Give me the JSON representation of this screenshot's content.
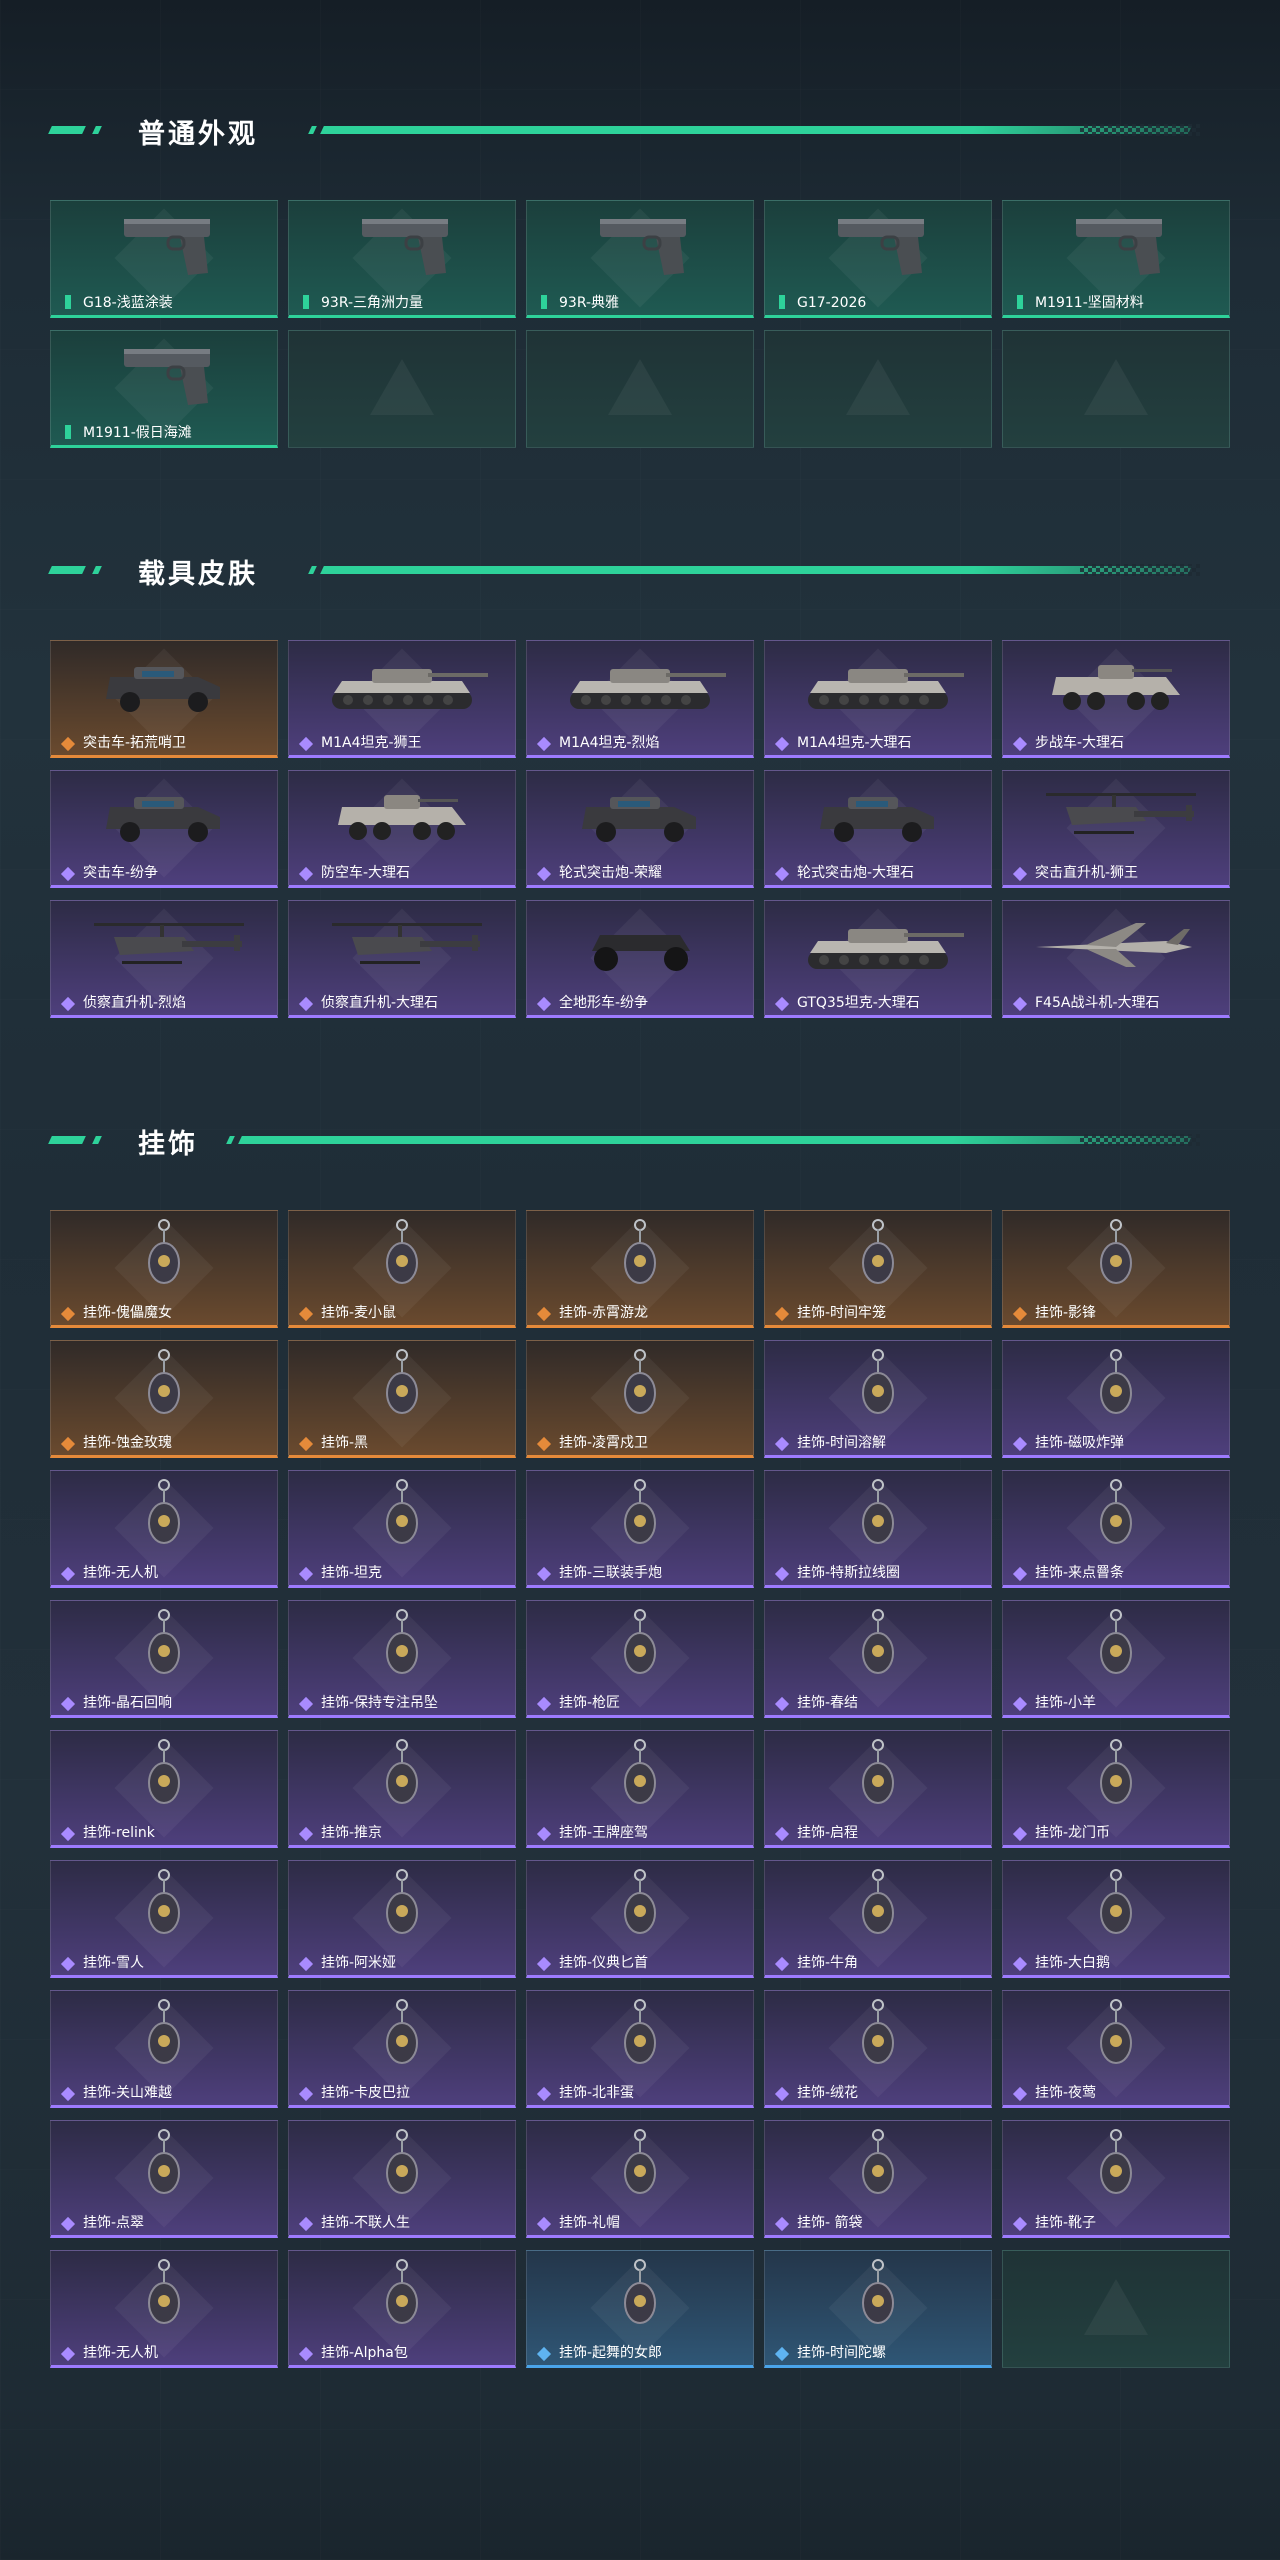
{
  "sections": [
    {
      "title": "普通外观",
      "items": [
        {
          "label": "G18-浅蓝涂装",
          "rarity": "green",
          "icon": "pistol-icon"
        },
        {
          "label": "93R-三角洲力量",
          "rarity": "green",
          "icon": "pistol-icon"
        },
        {
          "label": "93R-典雅",
          "rarity": "green",
          "icon": "pistol-icon"
        },
        {
          "label": "G17-2026",
          "rarity": "green",
          "icon": "pistol-icon"
        },
        {
          "label": "M1911-坚固材料",
          "rarity": "green",
          "icon": "pistol-icon"
        },
        {
          "label": "M1911-假日海滩",
          "rarity": "green",
          "icon": "pistol-icon"
        },
        {
          "label": "",
          "rarity": "empty"
        },
        {
          "label": "",
          "rarity": "empty"
        },
        {
          "label": "",
          "rarity": "empty"
        },
        {
          "label": "",
          "rarity": "empty"
        }
      ]
    },
    {
      "title": "载具皮肤",
      "items": [
        {
          "label": "突击车-拓荒哨卫",
          "rarity": "orange",
          "icon": "car-icon"
        },
        {
          "label": "M1A4坦克-狮王",
          "rarity": "purple",
          "icon": "tank-icon"
        },
        {
          "label": "M1A4坦克-烈焰",
          "rarity": "purple",
          "icon": "tank-icon"
        },
        {
          "label": "M1A4坦克-大理石",
          "rarity": "purple",
          "icon": "tank-icon"
        },
        {
          "label": "步战车-大理石",
          "rarity": "purple",
          "icon": "apc-icon"
        },
        {
          "label": "突击车-纷争",
          "rarity": "purple",
          "icon": "car-icon"
        },
        {
          "label": "防空车-大理石",
          "rarity": "purple",
          "icon": "apc-icon"
        },
        {
          "label": "轮式突击炮-荣耀",
          "rarity": "purple",
          "icon": "car-icon"
        },
        {
          "label": "轮式突击炮-大理石",
          "rarity": "purple",
          "icon": "car-icon"
        },
        {
          "label": "突击直升机-狮王",
          "rarity": "purple",
          "icon": "helicopter-icon"
        },
        {
          "label": "侦察直升机-烈焰",
          "rarity": "purple",
          "icon": "helicopter-icon"
        },
        {
          "label": "侦察直升机-大理石",
          "rarity": "purple",
          "icon": "helicopter-icon"
        },
        {
          "label": "全地形车-纷争",
          "rarity": "purple",
          "icon": "atv-icon"
        },
        {
          "label": "GTQ35坦克-大理石",
          "rarity": "purple",
          "icon": "tank-icon"
        },
        {
          "label": "F45A战斗机-大理石",
          "rarity": "purple",
          "icon": "jet-icon"
        }
      ]
    },
    {
      "title": "挂饰",
      "items": [
        {
          "label": "挂饰-傀儡魔女",
          "rarity": "orange",
          "icon": "charm-icon"
        },
        {
          "label": "挂饰-麦小鼠",
          "rarity": "orange",
          "icon": "charm-icon"
        },
        {
          "label": "挂饰-赤霄游龙",
          "rarity": "orange",
          "icon": "charm-icon"
        },
        {
          "label": "挂饰-时间牢笼",
          "rarity": "orange",
          "icon": "charm-icon"
        },
        {
          "label": "挂饰-影锋",
          "rarity": "orange",
          "icon": "charm-icon"
        },
        {
          "label": "挂饰-蚀金玫瑰",
          "rarity": "orange",
          "icon": "charm-icon"
        },
        {
          "label": "挂饰-黑",
          "rarity": "orange",
          "icon": "charm-icon"
        },
        {
          "label": "挂饰-凌霄戍卫",
          "rarity": "orange",
          "icon": "charm-icon"
        },
        {
          "label": "挂饰-时间溶解",
          "rarity": "purple",
          "icon": "charm-icon"
        },
        {
          "label": "挂饰-磁吸炸弹",
          "rarity": "purple",
          "icon": "charm-icon"
        },
        {
          "label": "挂饰-无人机",
          "rarity": "purple",
          "icon": "charm-icon"
        },
        {
          "label": "挂饰-坦克",
          "rarity": "purple",
          "icon": "charm-icon"
        },
        {
          "label": "挂饰-三联装手炮",
          "rarity": "purple",
          "icon": "charm-icon"
        },
        {
          "label": "挂饰-特斯拉线圈",
          "rarity": "purple",
          "icon": "charm-icon"
        },
        {
          "label": "挂饰-来点罾条",
          "rarity": "purple",
          "icon": "charm-icon"
        },
        {
          "label": "挂饰-晶石回响",
          "rarity": "purple",
          "icon": "charm-icon"
        },
        {
          "label": "挂饰-保持专注吊坠",
          "rarity": "purple",
          "icon": "charm-icon"
        },
        {
          "label": "挂饰-枪匠",
          "rarity": "purple",
          "icon": "charm-icon"
        },
        {
          "label": "挂饰-春结",
          "rarity": "purple",
          "icon": "charm-icon"
        },
        {
          "label": "挂饰-小羊",
          "rarity": "purple",
          "icon": "charm-icon"
        },
        {
          "label": "挂饰-relink",
          "rarity": "purple",
          "icon": "charm-icon"
        },
        {
          "label": "挂饰-推京",
          "rarity": "purple",
          "icon": "charm-icon"
        },
        {
          "label": "挂饰-王牌座驾",
          "rarity": "purple",
          "icon": "charm-icon"
        },
        {
          "label": "挂饰-启程",
          "rarity": "purple",
          "icon": "charm-icon"
        },
        {
          "label": "挂饰-龙门币",
          "rarity": "purple",
          "icon": "charm-icon"
        },
        {
          "label": "挂饰-雪人",
          "rarity": "purple",
          "icon": "charm-icon"
        },
        {
          "label": "挂饰-阿米娅",
          "rarity": "purple",
          "icon": "charm-icon"
        },
        {
          "label": "挂饰-仪典匕首",
          "rarity": "purple",
          "icon": "charm-icon"
        },
        {
          "label": "挂饰-牛角",
          "rarity": "purple",
          "icon": "charm-icon"
        },
        {
          "label": "挂饰-大白鹅",
          "rarity": "purple",
          "icon": "charm-icon"
        },
        {
          "label": "挂饰-关山难越",
          "rarity": "purple",
          "icon": "charm-icon"
        },
        {
          "label": "挂饰-卡皮巴拉",
          "rarity": "purple",
          "icon": "charm-icon"
        },
        {
          "label": "挂饰-北非蛋",
          "rarity": "purple",
          "icon": "charm-icon"
        },
        {
          "label": "挂饰-绒花",
          "rarity": "purple",
          "icon": "charm-icon"
        },
        {
          "label": "挂饰-夜莺",
          "rarity": "purple",
          "icon": "charm-icon"
        },
        {
          "label": "挂饰-点翠",
          "rarity": "purple",
          "icon": "charm-icon"
        },
        {
          "label": "挂饰-不联人生",
          "rarity": "purple",
          "icon": "charm-icon"
        },
        {
          "label": "挂饰-礼帽",
          "rarity": "purple",
          "icon": "charm-icon"
        },
        {
          "label": "挂饰- 箭袋",
          "rarity": "purple",
          "icon": "charm-icon"
        },
        {
          "label": "挂饰-靴子",
          "rarity": "purple",
          "icon": "charm-icon"
        },
        {
          "label": "挂饰-无人机",
          "rarity": "purple",
          "icon": "charm-icon"
        },
        {
          "label": "挂饰-Alpha包",
          "rarity": "purple",
          "icon": "charm-icon"
        },
        {
          "label": "挂饰-起舞的女郎",
          "rarity": "blue",
          "icon": "charm-icon"
        },
        {
          "label": "挂饰-时间陀螺",
          "rarity": "blue",
          "icon": "charm-icon"
        },
        {
          "label": "",
          "rarity": "empty"
        }
      ]
    }
  ],
  "colors": {
    "accent": "#2ed29a",
    "orange": "#e58a3a",
    "purple": "#9e7bff",
    "blue": "#4aa4ea"
  }
}
